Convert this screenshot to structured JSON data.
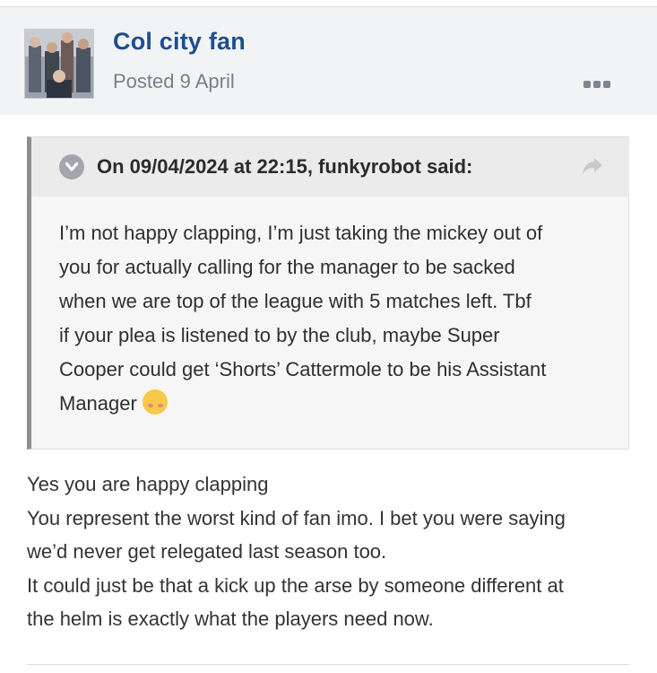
{
  "post": {
    "author": "Col city fan",
    "posted": "Posted 9 April",
    "more_icon": "ellipsis-icon"
  },
  "quote": {
    "citation": "On 09/04/2024 at 22:15, funkyrobot said:",
    "toggle_icon": "chevron-down-icon",
    "share_icon": "share-arrow-icon",
    "lines": [
      "I’m not happy clapping, I’m just taking the mickey out of",
      "you for actually calling for the manager to be sacked",
      "when we are top of the league with 5 matches left. Tbf",
      "if your plea is listened to by the club, maybe Super",
      "Cooper could get ‘Shorts’ Cattermole to be his Assistant",
      "Manager"
    ],
    "emoji": "smiling-face-with-hearts-emoji"
  },
  "reply": {
    "lines": [
      "Yes you are happy clapping",
      "You represent the worst kind of fan imo. I bet you were saying",
      "we’d never get relegated last season too.",
      "It could just be that a kick up the arse by someone different at",
      "the helm is exactly what the players need now."
    ]
  },
  "colors": {
    "author": "#1d4f8c",
    "header_bg": "#f2f3f5",
    "quote_bg": "#f6f6f6",
    "quote_border": "#8d8d8d"
  }
}
